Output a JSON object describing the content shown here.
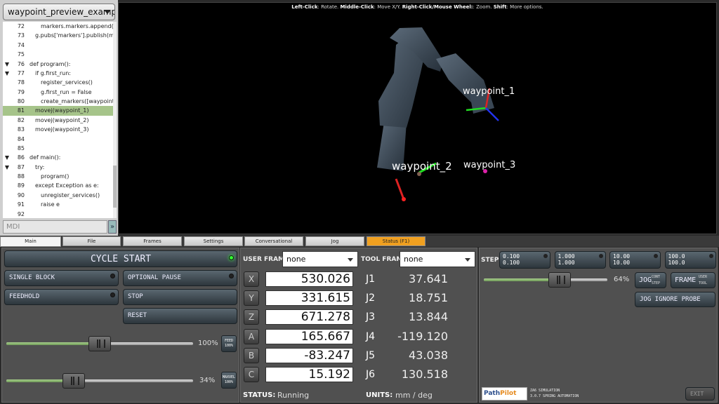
{
  "file_selector": {
    "value": "waypoint_preview_example..."
  },
  "code": {
    "lines": [
      {
        "n": "72",
        "fold": false,
        "indent": 2,
        "text": "markers.markers.append(mark..."
      },
      {
        "n": "73",
        "fold": false,
        "indent": 1,
        "text": "g.pubs['markers'].publish(marke..."
      },
      {
        "n": "74",
        "fold": false,
        "indent": 0,
        "text": ""
      },
      {
        "n": "75",
        "fold": false,
        "indent": 0,
        "text": ""
      },
      {
        "n": "76",
        "fold": true,
        "indent": 0,
        "text": "def program():"
      },
      {
        "n": "77",
        "fold": true,
        "indent": 1,
        "text": "if g.first_run:"
      },
      {
        "n": "78",
        "fold": false,
        "indent": 2,
        "text": "register_services()"
      },
      {
        "n": "79",
        "fold": false,
        "indent": 2,
        "text": "g.first_run = False"
      },
      {
        "n": "80",
        "fold": false,
        "indent": 2,
        "text": "create_markers([waypoint_1, ..."
      },
      {
        "n": "81",
        "fold": false,
        "indent": 1,
        "text": "movej(waypoint_1)",
        "highlight": true
      },
      {
        "n": "82",
        "fold": false,
        "indent": 1,
        "text": "movej(waypoint_2)"
      },
      {
        "n": "83",
        "fold": false,
        "indent": 1,
        "text": "movej(waypoint_3)"
      },
      {
        "n": "84",
        "fold": false,
        "indent": 0,
        "text": ""
      },
      {
        "n": "85",
        "fold": false,
        "indent": 0,
        "text": ""
      },
      {
        "n": "86",
        "fold": true,
        "indent": 0,
        "text": "def main():"
      },
      {
        "n": "87",
        "fold": true,
        "indent": 1,
        "text": "try:"
      },
      {
        "n": "88",
        "fold": false,
        "indent": 2,
        "text": "program()"
      },
      {
        "n": "89",
        "fold": false,
        "indent": 1,
        "text": "except Exception as e:"
      },
      {
        "n": "90",
        "fold": false,
        "indent": 2,
        "text": "unregister_services()"
      },
      {
        "n": "91",
        "fold": false,
        "indent": 2,
        "text": "raise e"
      },
      {
        "n": "92",
        "fold": false,
        "indent": 0,
        "text": ""
      }
    ],
    "highlight_color": "#a6c48a"
  },
  "mdi": {
    "placeholder": "MDI"
  },
  "viewport": {
    "hint_parts": [
      {
        "b": "Left-Click",
        "t": ": Rotate. "
      },
      {
        "b": "Middle-Click",
        "t": ": Move X/Y. "
      },
      {
        "b": "Right-Click/Mouse Wheel:",
        "t": ": Zoom. "
      },
      {
        "b": "Shift",
        "t": ": More options."
      }
    ],
    "waypoints": [
      "waypoint_1",
      "waypoint_2",
      "waypoint_3"
    ]
  },
  "tabs": [
    "Main",
    "File",
    "Frames",
    "Settings",
    "Conversational",
    "Jog",
    "Status (F1)"
  ],
  "controls": {
    "cycle_start": "CYCLE START",
    "single_block": "SINGLE BLOCK",
    "optional_pause": "OPTIONAL PAUSE",
    "feedhold": "FEEDHOLD",
    "stop": "STOP",
    "reset": "RESET",
    "feed_pct": "100%",
    "feed_label": "FEED 100%",
    "feed_fraction": 1.0,
    "maxvel_pct": "34%",
    "maxvel_label": "MAXVEL 100%",
    "maxvel_fraction": 0.34
  },
  "dro": {
    "user_frame_label": "USER FRAME:",
    "user_frame_value": "none",
    "tool_frame_label": "TOOL FRAME:",
    "tool_frame_value": "none",
    "axes": [
      {
        "axis": "X",
        "value": "530.026",
        "joint": "J1",
        "joint_value": "37.641"
      },
      {
        "axis": "Y",
        "value": "331.615",
        "joint": "J2",
        "joint_value": "18.751"
      },
      {
        "axis": "Z",
        "value": "671.278",
        "joint": "J3",
        "joint_value": "13.844"
      },
      {
        "axis": "A",
        "value": "165.667",
        "joint": "J4",
        "joint_value": "-119.120"
      },
      {
        "axis": "B",
        "value": "-83.247",
        "joint": "J5",
        "joint_value": "43.038"
      },
      {
        "axis": "C",
        "value": "15.192",
        "joint": "J6",
        "joint_value": "130.518"
      }
    ],
    "status_label": "STATUS:",
    "status_value": "Running",
    "units_label": "UNITS:",
    "units_value": "mm / deg"
  },
  "jog": {
    "step_label": "STEP:",
    "steps": [
      {
        "a": "0.100",
        "b": "0.100"
      },
      {
        "a": "1.000",
        "b": "1.000"
      },
      {
        "a": "10.00",
        "b": "10.00"
      },
      {
        "a": "100.0",
        "b": "100.0"
      }
    ],
    "jog_pct": "64%",
    "jog_fraction": 0.64,
    "jog_btn": "JOG",
    "cont": "CONT",
    "step": "STEP",
    "frame_btn": "FRAME",
    "user": "USER",
    "tool": "TOOL",
    "ignore_probe": "JOG IGNORE PROBE",
    "logo_path": "Path",
    "logo_pilot": "Pilot",
    "sim_line1": "ZA6 SIMULATION",
    "sim_line2": "3.0.7 SPRING AUTOMATION",
    "exit": "EXIT"
  },
  "colors": {
    "status_tab": "#f0a020",
    "led_on": "#33ff33",
    "slider_fill": "#8fbf72"
  }
}
